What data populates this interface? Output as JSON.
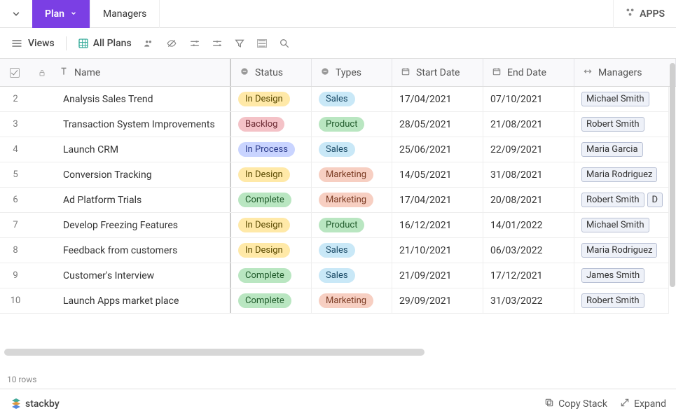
{
  "tabs": {
    "plan": "Plan",
    "managers": "Managers"
  },
  "apps_label": "APPS",
  "toolbar": {
    "views": "Views",
    "all_plans": "All Plans"
  },
  "headers": {
    "name": "Name",
    "status": "Status",
    "types": "Types",
    "start": "Start Date",
    "end": "End Date",
    "managers": "Managers"
  },
  "status_labels": {
    "in_design": "In Design",
    "backlog": "Backlog",
    "in_process": "In Process",
    "complete": "Complete"
  },
  "type_labels": {
    "sales": "Sales",
    "product": "Product",
    "marketing": "Marketing"
  },
  "rows": [
    {
      "num": "2",
      "name": "Analysis Sales Trend",
      "status": "in_design",
      "type": "sales",
      "start": "17/04/2021",
      "end": "07/10/2021",
      "managers": [
        "Michael Smith"
      ]
    },
    {
      "num": "3",
      "name": "Transaction System Improvements",
      "status": "backlog",
      "type": "product",
      "start": "28/05/2021",
      "end": "21/08/2021",
      "managers": [
        "Robert Smith"
      ]
    },
    {
      "num": "4",
      "name": "Launch CRM",
      "status": "in_process",
      "type": "sales",
      "start": "25/06/2021",
      "end": "22/09/2021",
      "managers": [
        "Maria Garcia"
      ]
    },
    {
      "num": "5",
      "name": "Conversion Tracking",
      "status": "in_design",
      "type": "marketing",
      "start": "14/05/2021",
      "end": "31/08/2021",
      "managers": [
        "Maria Rodriguez"
      ]
    },
    {
      "num": "6",
      "name": "Ad Platform Trials",
      "status": "complete",
      "type": "marketing",
      "start": "17/04/2021",
      "end": "20/08/2021",
      "managers": [
        "Robert Smith",
        "D"
      ]
    },
    {
      "num": "7",
      "name": "Develop Freezing Features",
      "status": "in_design",
      "type": "product",
      "start": "16/12/2021",
      "end": "14/01/2022",
      "managers": [
        "Michael Smith"
      ]
    },
    {
      "num": "8",
      "name": "Feedback from customers",
      "status": "in_design",
      "type": "sales",
      "start": "21/10/2021",
      "end": "06/03/2022",
      "managers": [
        "Maria Rodriguez"
      ]
    },
    {
      "num": "9",
      "name": "Customer's Interview",
      "status": "complete",
      "type": "sales",
      "start": "21/09/2021",
      "end": "17/12/2021",
      "managers": [
        "James Smith"
      ]
    },
    {
      "num": "10",
      "name": "Launch Apps market place",
      "status": "complete",
      "type": "marketing",
      "start": "29/09/2021",
      "end": "31/03/2022",
      "managers": [
        "Robert Smith"
      ]
    }
  ],
  "row_count": "10 rows",
  "footer": {
    "brand": "stackby",
    "copy": "Copy Stack",
    "expand": "Expand"
  },
  "colors": {
    "accent": "#7b3fe4"
  }
}
